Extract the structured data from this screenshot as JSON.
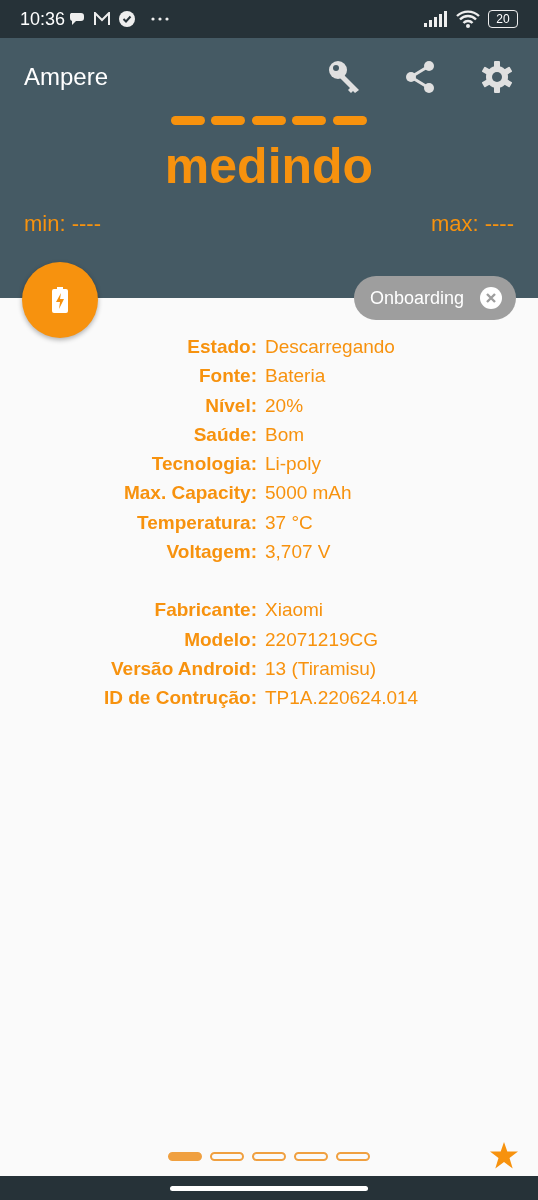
{
  "status_bar": {
    "time": "10:36",
    "battery": "20"
  },
  "app_bar": {
    "title": "Ampere"
  },
  "reading": {
    "value": "medindo",
    "min": "min: ----",
    "max": "max: ----"
  },
  "chip": {
    "label": "Onboarding"
  },
  "info_groups": [
    [
      {
        "label": "Estado:",
        "value": "Descarregando"
      },
      {
        "label": "Fonte:",
        "value": "Bateria"
      },
      {
        "label": "Nível:",
        "value": "20%"
      },
      {
        "label": "Saúde:",
        "value": "Bom"
      },
      {
        "label": "Tecnologia:",
        "value": "Li-poly"
      },
      {
        "label": "Max. Capacity:",
        "value": "5000 mAh"
      },
      {
        "label": "Temperatura:",
        "value": "37 °C"
      },
      {
        "label": "Voltagem:",
        "value": "3,707 V"
      }
    ],
    [
      {
        "label": "Fabricante:",
        "value": "Xiaomi"
      },
      {
        "label": "Modelo:",
        "value": "22071219CG"
      },
      {
        "label": "Versão Android:",
        "value": "13 (Tiramisu)"
      },
      {
        "label": "ID de Contrução:",
        "value": "TP1A.220624.014"
      }
    ]
  ],
  "pages": [
    {
      "selected": true
    },
    {
      "selected": false
    },
    {
      "selected": false
    },
    {
      "selected": false
    },
    {
      "selected": false
    }
  ]
}
